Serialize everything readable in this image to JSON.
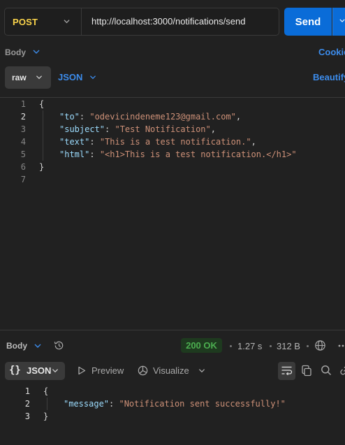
{
  "request": {
    "method": "POST",
    "url": "http://localhost:3000/notifications/send",
    "send_label": "Send"
  },
  "request_tabs": {
    "body_label": "Body",
    "cookies_label": "Cookie",
    "raw_label": "raw",
    "format_label": "JSON",
    "beautify_label": "Beautify"
  },
  "request_body": {
    "line_numbers": [
      "1",
      "2",
      "3",
      "4",
      "5",
      "6",
      "7"
    ],
    "open_brace": "{",
    "close_brace": "}",
    "fields": [
      {
        "key": "\"to\"",
        "value": "\"odevicindeneme123@gmail.com\"",
        "trail": ","
      },
      {
        "key": "\"subject\"",
        "value": "\"Test Notification\"",
        "trail": ","
      },
      {
        "key": "\"text\"",
        "value": "\"This is a test notification.\"",
        "trail": ","
      },
      {
        "key": "\"html\"",
        "value": "\"<h1>This is a test notification.</h1>\"",
        "trail": ""
      }
    ],
    "colon": ": "
  },
  "response_bar": {
    "body_label": "Body",
    "status": "200 OK",
    "time": "1.27 s",
    "size": "312 B"
  },
  "response_tabs": {
    "format_icon_text": "{}",
    "format_label": "JSON",
    "preview_label": "Preview",
    "visualize_label": "Visualize"
  },
  "response_body": {
    "line_numbers": [
      "1",
      "2",
      "3"
    ],
    "open_brace": "{",
    "close_brace": "}",
    "key": "\"message\"",
    "colon": ": ",
    "value": "\"Notification sent successfully!\""
  },
  "colors": {
    "background": "#212121",
    "accent": "#0a6cd8",
    "method": "#f8d24a",
    "link": "#3c8cec",
    "status_ok": "#4caf50",
    "json_key": "#9cdcfe",
    "json_string": "#ce9178"
  },
  "icons": [
    "chevron-down-icon",
    "history-icon",
    "globe-icon",
    "more-icon",
    "play-icon",
    "visualize-icon",
    "wrap-icon",
    "copy-icon",
    "search-icon",
    "link-icon"
  ]
}
